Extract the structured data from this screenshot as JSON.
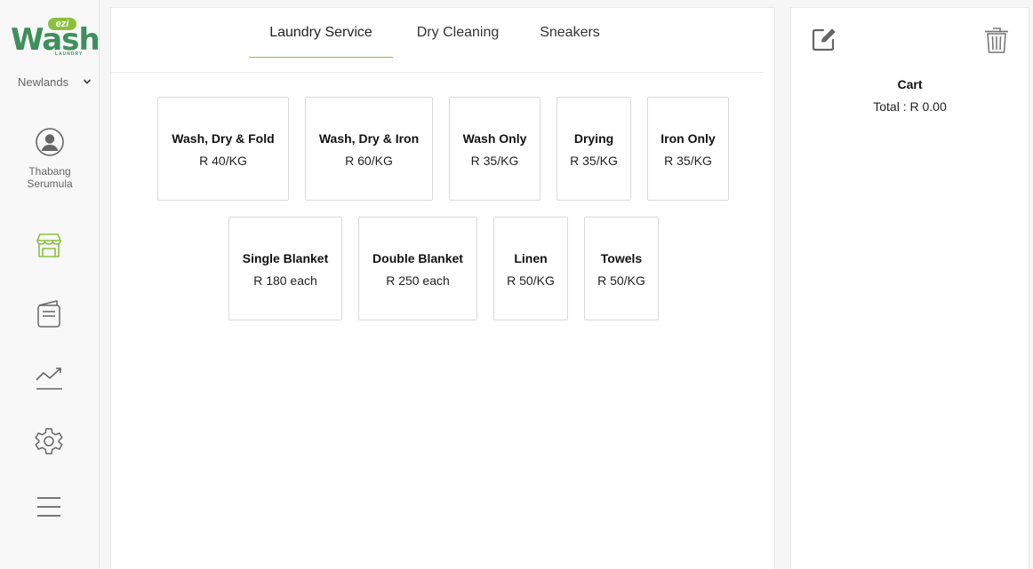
{
  "brand": {
    "logo_small": "ezi",
    "logo_main": "Wash",
    "logo_sub": "LAUNDRY",
    "accent": "#8cbf3f",
    "green": "#3e8f5b"
  },
  "sidebar": {
    "branch": "Newlands",
    "user": {
      "first": "Thabang",
      "last": "Serumula",
      "icon": "user-circle-icon"
    },
    "nav": [
      {
        "icon": "store-icon"
      },
      {
        "icon": "orders-icon"
      },
      {
        "icon": "analytics-icon"
      },
      {
        "icon": "settings-icon"
      },
      {
        "icon": "menu-icon"
      }
    ]
  },
  "tabs": [
    {
      "label": "Laundry Service",
      "active": true
    },
    {
      "label": "Dry Cleaning",
      "active": false
    },
    {
      "label": "Sneakers",
      "active": false
    }
  ],
  "services": [
    {
      "name": "Wash, Dry & Fold",
      "price": "R 40/KG"
    },
    {
      "name": "Wash, Dry & Iron",
      "price": "R 60/KG"
    },
    {
      "name": "Wash Only",
      "price": "R 35/KG"
    },
    {
      "name": "Drying",
      "price": "R 35/KG"
    },
    {
      "name": "Iron Only",
      "price": "R 35/KG"
    },
    {
      "name": "Single Blanket",
      "price": "R 180 each"
    },
    {
      "name": "Double Blanket",
      "price": "R 250 each"
    },
    {
      "name": "Linen",
      "price": "R 50/KG"
    },
    {
      "name": "Towels",
      "price": "R 50/KG"
    }
  ],
  "cart": {
    "title": "Cart",
    "total": "Total : R 0.00",
    "edit_icon": "edit-icon",
    "delete_icon": "trash-icon"
  }
}
